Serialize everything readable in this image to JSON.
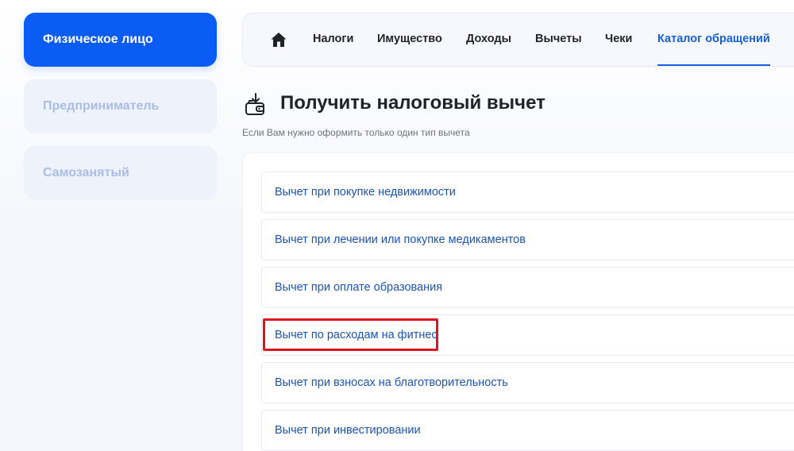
{
  "sidebar": {
    "items": [
      {
        "label": "Физическое лицо",
        "active": true
      },
      {
        "label": "Предприниматель",
        "active": false
      },
      {
        "label": "Самозанятый",
        "active": false
      }
    ]
  },
  "topnav": {
    "home_icon": "home-icon",
    "items": [
      {
        "label": "Налоги"
      },
      {
        "label": "Имущество"
      },
      {
        "label": "Доходы"
      },
      {
        "label": "Вычеты"
      },
      {
        "label": "Чеки"
      },
      {
        "label": "Каталог обращений",
        "active": true
      }
    ]
  },
  "main": {
    "title": "Получить налоговый вычет",
    "title_icon": "wallet-download-icon",
    "subtitle": "Если Вам нужно оформить только один тип вычета",
    "deductions": [
      {
        "label": "Вычет при покупке недвижимости"
      },
      {
        "label": "Вычет при лечении или покупке медикаментов"
      },
      {
        "label": "Вычет при оплате образования"
      },
      {
        "label": "Вычет по расходам на фитнес",
        "highlighted": true
      },
      {
        "label": "Вычет при взносах на благотворительность"
      },
      {
        "label": "Вычет при инвестировании"
      }
    ]
  },
  "colors": {
    "accent": "#0a5cf5",
    "link": "#1a54b8",
    "highlight_border": "#e0121d"
  }
}
